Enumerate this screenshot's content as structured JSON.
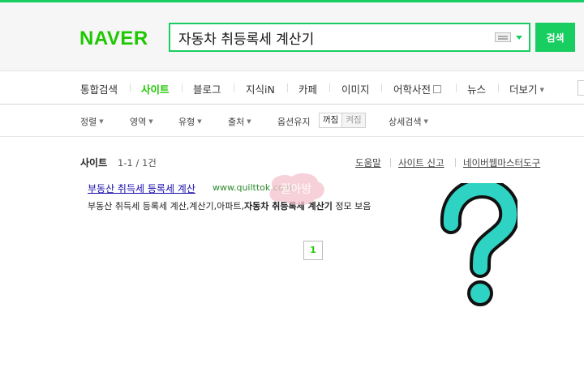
{
  "brand": {
    "logo_text": "NAVER",
    "accent_color": "#1ec800"
  },
  "search": {
    "query": "자동차 취등록세 계산기",
    "button_label": "검색"
  },
  "tabs": [
    {
      "label": "통합검색",
      "active": false
    },
    {
      "label": "사이트",
      "active": true
    },
    {
      "label": "블로그",
      "active": false
    },
    {
      "label": "지식iN",
      "active": false
    },
    {
      "label": "카페",
      "active": false
    },
    {
      "label": "이미지",
      "active": false
    },
    {
      "label": "어학사전",
      "active": false
    },
    {
      "label": "뉴스",
      "active": false
    },
    {
      "label": "더보기",
      "active": false
    }
  ],
  "filters": {
    "sort": "정렬",
    "area": "영역",
    "type": "유형",
    "source": "출처",
    "option_keep": "옵션유지",
    "toggle_on": "꺼짐",
    "toggle_off": "켜짐",
    "detail_search": "상세검색"
  },
  "section": {
    "title": "사이트",
    "count": "1-1 / 1건",
    "links": [
      "도움말",
      "사이트 신고",
      "네이버웹마스터도구"
    ]
  },
  "result": {
    "title": "부동산 취득세 등록세 계산",
    "url": "www.quilttok.com",
    "desc_plain": "부동산 취득세 등록세 계산,계산기,아파트,",
    "desc_bold": "자동차 취등록세 계산기",
    "desc_tail": " 정모 보음"
  },
  "pagination": {
    "current": "1"
  },
  "decorations": {
    "watermark_text": "퀼아방",
    "question_mark_color": "#2ed3c3"
  }
}
